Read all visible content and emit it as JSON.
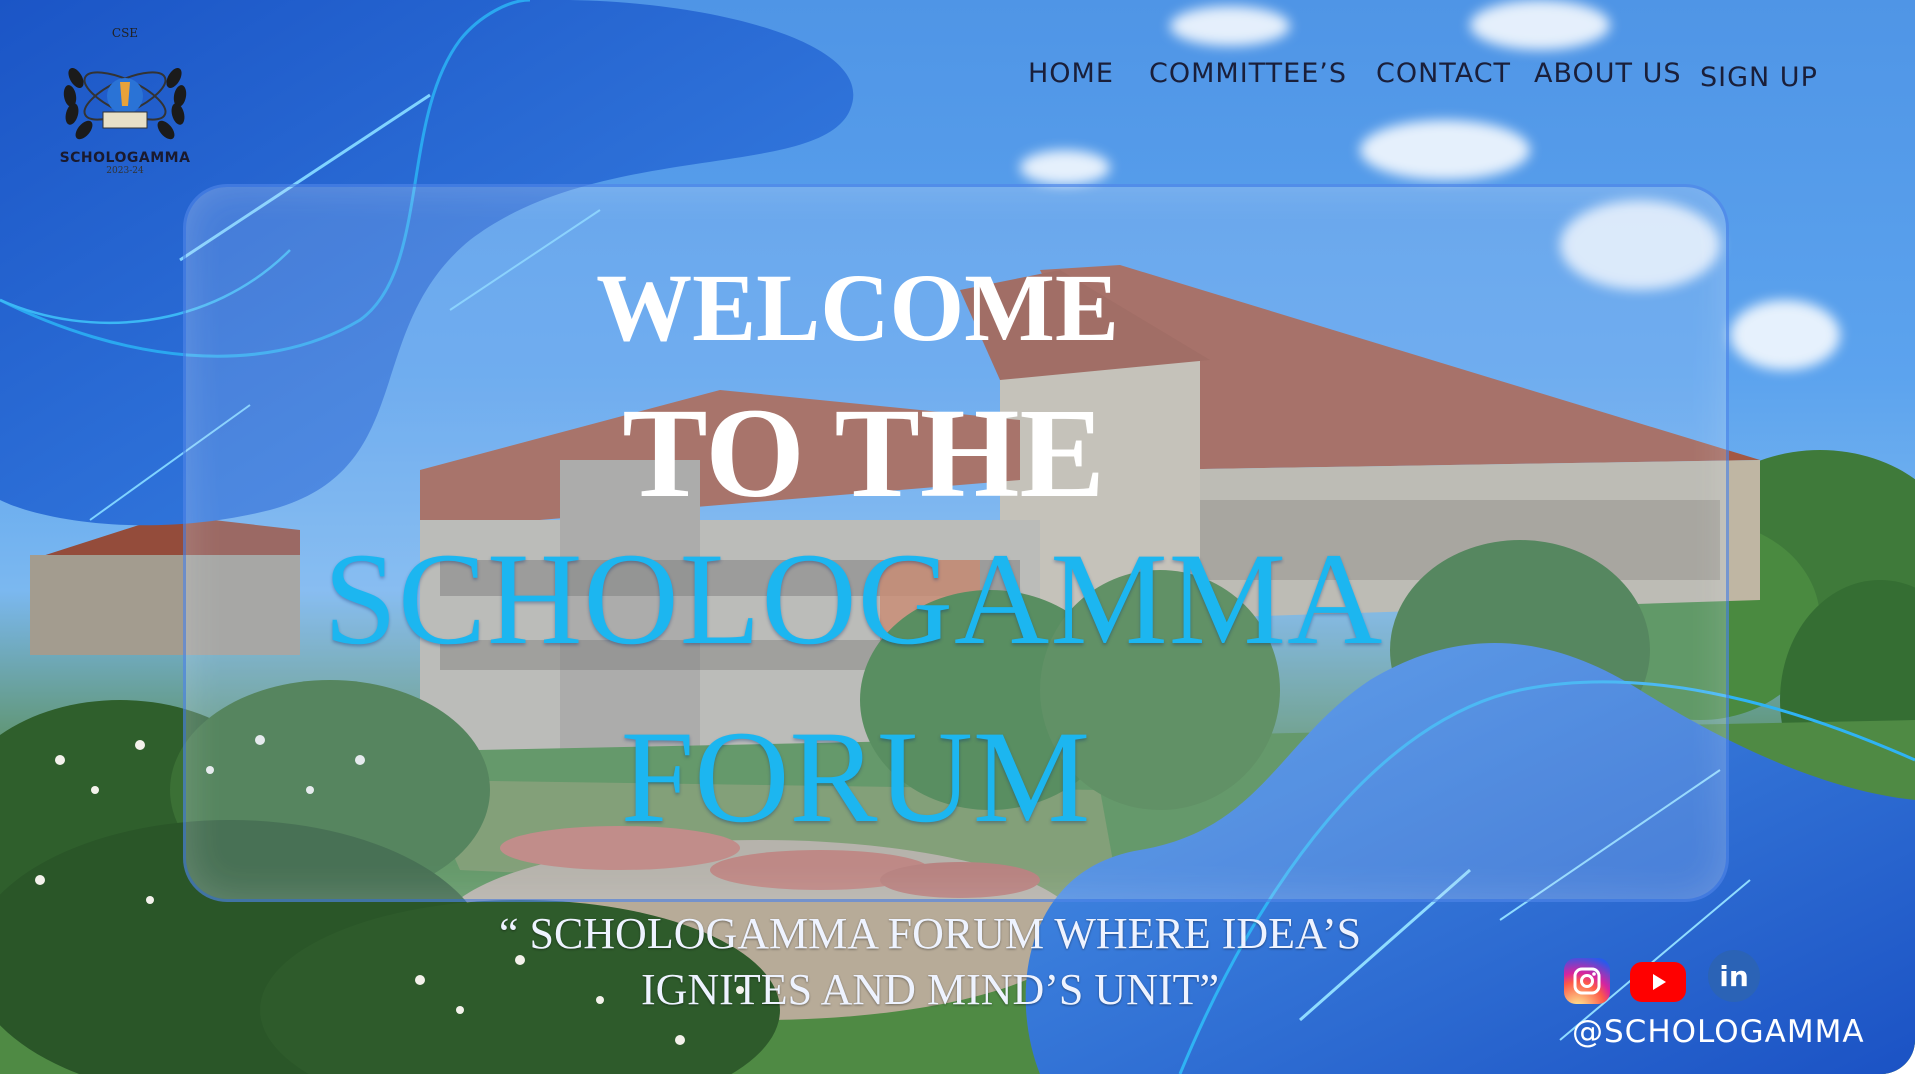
{
  "nav": {
    "home": "HOME",
    "committees": "COMMITTEE’S",
    "contact": "CONTACT",
    "about": "ABOUT US",
    "signup": "SIGN UP"
  },
  "logo": {
    "top_text": "CSE",
    "name": "SCHOLOGAMMA",
    "year": "2023-24"
  },
  "hero": {
    "line1": "WELCOME",
    "line2": "TO THE",
    "line3": "SCHOLOGAMMA",
    "line4": "FORUM"
  },
  "quote": {
    "line1": "“ SCHOLOGAMMA FORUM WHERE IDEA’S",
    "line2": "IGNITES AND MIND’S UNIT”"
  },
  "social": {
    "icons": [
      "instagram-icon",
      "youtube-icon",
      "linkedin-icon"
    ],
    "linkedin_text": "in",
    "handle": "@SCHOLOGAMMA"
  },
  "colors": {
    "accent_blue": "#1cb6f0",
    "deep_blue": "#1a57c9",
    "nav_text": "#1a1f3a"
  }
}
